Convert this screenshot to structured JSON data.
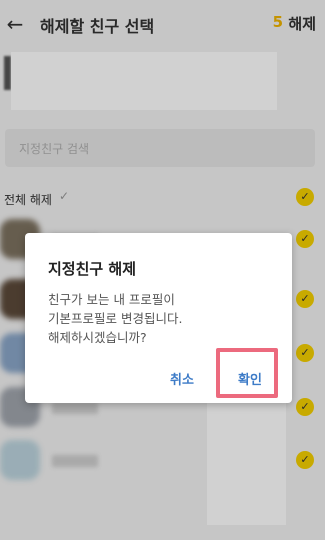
{
  "header": {
    "back_icon": "arrow-left-icon",
    "title": "해제할 친구 선택",
    "count": "5",
    "action_label": "해제"
  },
  "search": {
    "placeholder": "지정친구 검색"
  },
  "list": {
    "select_all_label": "전체 해제",
    "select_all_icon": "checkmark-icon",
    "rows": [
      {
        "avatar_color": "#7d7260"
      },
      {
        "avatar_color": "#5c4a3a"
      },
      {
        "avatar_color": "#8aa6c8"
      },
      {
        "avatar_color": "#a0a5ad"
      },
      {
        "avatar_color": "#bcd4de"
      }
    ]
  },
  "dialog": {
    "title": "지정친구 해제",
    "message": "친구가 보는 내 프로필이\n기본프로필로 변경됩니다.\n해제하시겠습니까?",
    "cancel_label": "취소",
    "confirm_label": "확인"
  },
  "colors": {
    "accent": "#f5d000",
    "link": "#3d7bc7",
    "highlight": "#ec6a7e",
    "count": "#f0b400"
  }
}
